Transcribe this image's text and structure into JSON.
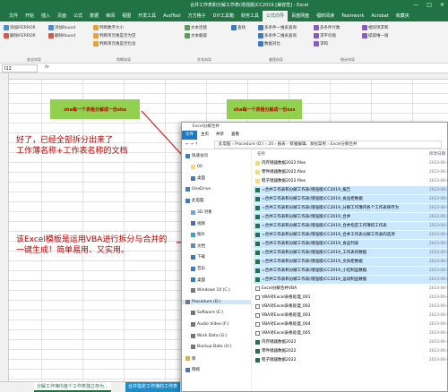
{
  "window": {
    "title": "合并工作表和分解工作表(增强版)CC2019 [兼容性] - Excel",
    "controls": [
      "—",
      "□",
      "✕"
    ]
  },
  "menu": [
    "文件",
    "开始",
    "插入",
    "页面",
    "公式",
    "数据",
    "审阅",
    "视图",
    "开发工具",
    "AudTool",
    "方方格子",
    "DIY工具箱",
    "财务工具",
    "公式向导",
    "百度网盘",
    "福昕阅读",
    "Teamwork",
    "Acrobat",
    "收藏夹"
  ],
  "active_menu": "公式向导",
  "ribbon": {
    "buttons": [
      "添加IFERROR",
      "删除IFERROR",
      "添加Round",
      "删除Round",
      "判断数字大小",
      "判断单元格是否为空",
      "判断单元格是否包含",
      "文本连接",
      "文本截取",
      "查找",
      "多条件一维表查询",
      "多条件二维表查询",
      "数据对比",
      "多条件计数",
      "求平均值",
      "求和",
      "相同项求和",
      "提取唯一值"
    ],
    "groups": [
      "安全向导",
      "判断向导",
      "文本向导",
      "查找向导",
      "统计向导"
    ]
  },
  "formula": {
    "name_box": "I12",
    "fx": "fx"
  },
  "cells": {
    "box1": "sha每一个表格分解成一份sha",
    "box2": "sha每一个表格分解成一份sss",
    "note1_l1": "好了，已经全部拆分出来了",
    "note1_l2": "工作薄名称+工作表名称的文档",
    "note2_l1": "该Excel模板是运用VBA进行拆分与合并的",
    "note2_l2": "一键生成！简单易用、又实用。"
  },
  "sheet_tabs": [
    "分解工作簿内各个工作表独立存为...",
    "合并指定工作簿的工作表",
    "+"
  ],
  "explorer": {
    "title": "Excel分解合并",
    "menu": [
      "文件",
      "主页",
      "共享",
      "查看"
    ],
    "address": "此电脑 › Procedure (D:) › 20 › 报表 › 蔡雅编辑、发帖案例 › Excel分解合并",
    "nav": [
      "快速访问",
      "00",
      "桌面",
      "OneDrive",
      "此电脑",
      "3D 对象",
      "视频",
      "图片",
      "文档",
      "下载",
      "音乐",
      "桌面",
      "Windows 10 (C:)",
      "Procedure (D:)",
      "Software (E:)",
      "Audio Video (F:)",
      "Work Data (G:)",
      "Backup Data (H:)",
      "库",
      "网络"
    ],
    "columns": [
      "名称",
      "修改日期"
    ],
    "files": [
      {
        "name": "内存储器数据2022.files",
        "type": "folder",
        "date": "2023-06-07"
      },
      {
        "name": "零件储器数据2022.files",
        "type": "folder",
        "date": "2023-06-07"
      },
      {
        "name": "鞋子储器数据2022.files",
        "type": "folder",
        "date": "2023-06-07"
      },
      {
        "name": "=合并工作表和分解工作表(增强版)CC2019_报告",
        "type": "xls",
        "date": "2023-06-07"
      },
      {
        "name": "=合并工作表和分解工作表(增强版)CC2019_食品柜数据",
        "type": "xls",
        "date": "2023-06-07"
      },
      {
        "name": "=合并工作表和分解工作表(增强版)CC2019_分解工作簿内各个工作表保存为",
        "type": "xls",
        "date": "2023-06-07"
      },
      {
        "name": "=合并工作表和分解工作表(增强版)CC2019_合并",
        "type": "xls",
        "date": "2023-06-07"
      },
      {
        "name": "=合并工作表和分解工作表(增强版)CC2019_合并指定工作簿的工作表",
        "type": "xls",
        "date": "2023-06-07"
      },
      {
        "name": "=合并工作表和分解工作表(增强版)CC2019_合并工作表分解工作表的选项",
        "type": "xls",
        "date": "2023-06-07"
      },
      {
        "name": "=合并工作表和分解工作表(增强版)CC2019_食品列表",
        "type": "xls",
        "date": "2023-06-07"
      },
      {
        "name": "=合并工作表和分解工作表(增强版)CC2019_工作表的数据",
        "type": "xls",
        "date": "2023-06-07"
      },
      {
        "name": "=合并工作表和分解工作表(增强版)CC2019_文具柜数据",
        "type": "xls",
        "date": "2023-06-07"
      },
      {
        "name": "=合并工作表和分解工作表(增强版)CC2019_小吃制品数据",
        "type": "xls",
        "date": "2023-06-07"
      },
      {
        "name": "=合并工作表和分解工作表(增强版)CC2019_运动制品数据",
        "type": "xls",
        "date": "2023-06-07"
      },
      {
        "name": "Excel分解合并VBA",
        "type": "doc",
        "date": "2023-06-07"
      },
      {
        "name": "VBA对Excel表格处理_001",
        "type": "doc",
        "date": "2023-06-07"
      },
      {
        "name": "VBA对Excel表格处理_002",
        "type": "doc",
        "date": "2023-06-07"
      },
      {
        "name": "VBA对Excel表格处理_003",
        "type": "doc",
        "date": "2023-06-07"
      },
      {
        "name": "VBA对Excel表格处理_004",
        "type": "doc",
        "date": "2023-06-07"
      },
      {
        "name": "VBA对Excel表格处理_005",
        "type": "doc",
        "date": "2023-06-07"
      },
      {
        "name": "内存储器数据2022",
        "type": "xls",
        "date": "2023-06-07"
      },
      {
        "name": "零件储器数据2022",
        "type": "xls",
        "date": "2023-06-07"
      },
      {
        "name": "鞋子储器数据2022",
        "type": "xls",
        "date": "2023-06-07"
      }
    ]
  }
}
